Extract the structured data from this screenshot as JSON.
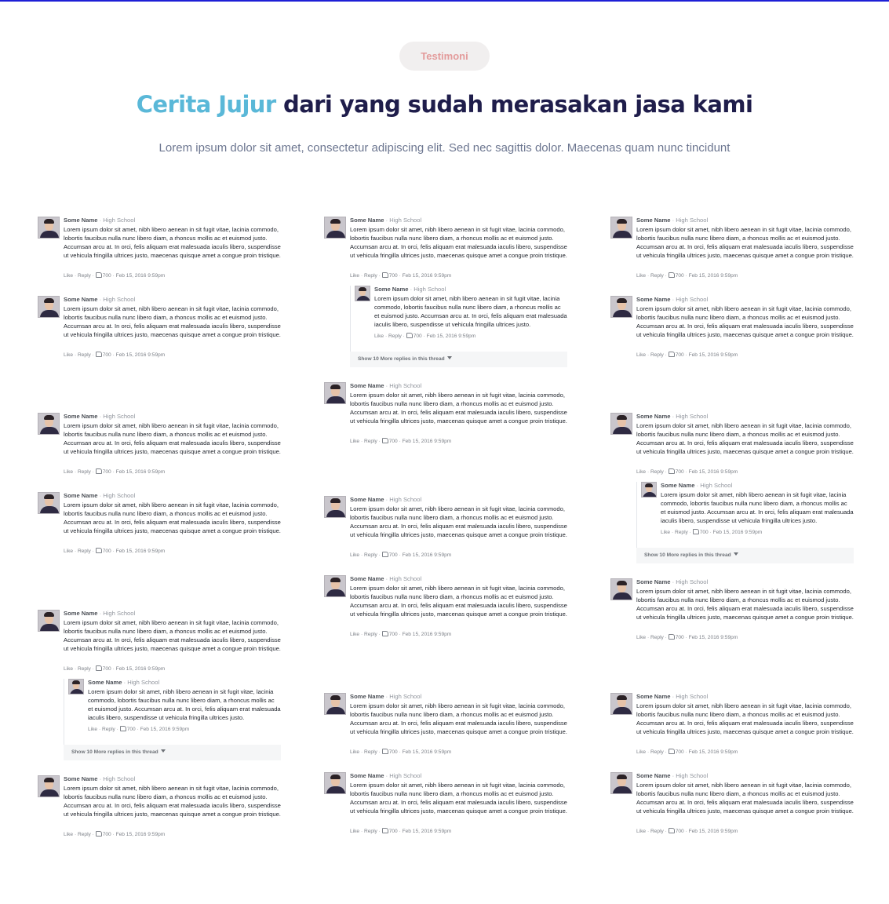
{
  "section": {
    "tag": "Testimoni",
    "heading_accent": "Cerita Jujur",
    "heading_rest": " dari yang sudah merasakan jasa kami",
    "subtitle": "Lorem ipsum dolor sit amet, consectetur adipiscing elit. Sed nec sagittis dolor. Maecenas quam nunc tincidunt"
  },
  "comment": {
    "name": "Some Name",
    "separator": " · ",
    "school": "High School",
    "text": "Lorem ipsum dolor sit amet, nibh libero aenean in sit fugit vitae, lacinia commodo, lobortis faucibus nulla nunc libero diam, a rhoncus mollis ac et euismod justo. Accumsan arcu at. In orci, felis aliquam erat malesuada iaculis libero, suspendisse ut vehicula fringilla ultrices justo, maecenas quisque amet a congue proin tristique.",
    "like": "Like",
    "reply": "Reply",
    "likes": "700",
    "date": "Feb 15, 2016 9:59pm"
  },
  "reply": {
    "name": "Some Name",
    "school": "High School",
    "text": "Lorem ipsum dolor sit amet, nibh libero aenean in sit fugit vitae, lacinia commodo, lobortis faucibus nulla nunc libero diam, a rhoncus mollis ac et euismod justo. Accumsan arcu at. In orci, felis aliquam erat malesuada iaculis libero, suspendisse ut vehicula fringilla ultrices justo.",
    "like": "Like",
    "reply": "Reply",
    "likes": "700",
    "date": "Feb 15, 2016 9:59pm",
    "show_more": "Show 10 More replies in this thread"
  },
  "colors": {
    "accent": "#5ab8d8",
    "heading": "#1f1d4b",
    "tag_text": "#e39b9b",
    "tag_bg": "#f1efef"
  }
}
